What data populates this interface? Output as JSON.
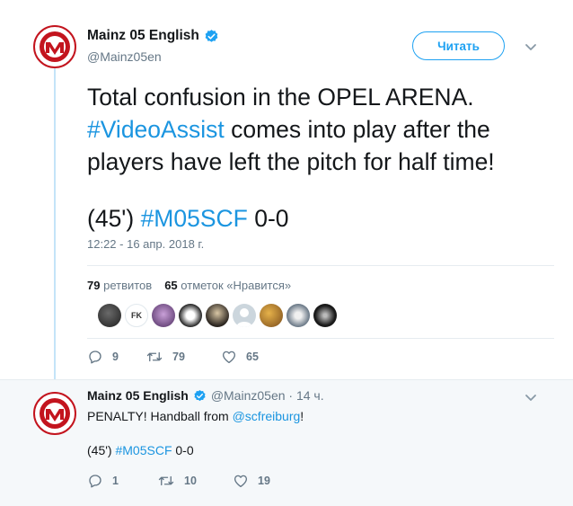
{
  "main_tweet": {
    "author_name": "Mainz 05 English",
    "author_handle": "@Mainz05en",
    "follow_label": "Читать",
    "text_line1": "Total confusion in the OPEL ARENA.",
    "hashtag_videoassist": "#VideoAssist",
    "text_line2_rest": " comes into play after the",
    "text_line3": "players have left the pitch for half time!",
    "text_prefix": "(45') ",
    "hashtag_m05scf": "#M05SCF",
    "text_suffix": " 0-0",
    "timestamp": "12:22 - 16 апр. 2018 г.",
    "retweets_count": "79",
    "retweets_label": "ретвитов",
    "likes_count": "65",
    "likes_label": "отметок «Нравится»",
    "liker_placeholder_text": "FK",
    "reply_count": "9",
    "retweet_action_count": "79",
    "like_action_count": "65"
  },
  "reply_tweet": {
    "author_name": "Mainz 05 English",
    "author_handle": "@Mainz05en",
    "time_sep": " · ",
    "time": "14 ч.",
    "text_prefix": "PENALTY! Handball from ",
    "mention": "@scfreiburg",
    "text_suffix": "!",
    "line2_prefix": "(45') ",
    "hashtag": "#M05SCF",
    "line2_suffix": " 0-0",
    "reply_count": "1",
    "retweet_count": "10",
    "like_count": "19"
  },
  "colors": {
    "accent": "#1da1f2",
    "link": "#1b95e0",
    "muted": "#657786",
    "club_red": "#c3141e"
  },
  "icons": [
    "verified-icon",
    "chevron-down-icon",
    "reply-icon",
    "retweet-icon",
    "like-icon",
    "mainz05-logo"
  ]
}
